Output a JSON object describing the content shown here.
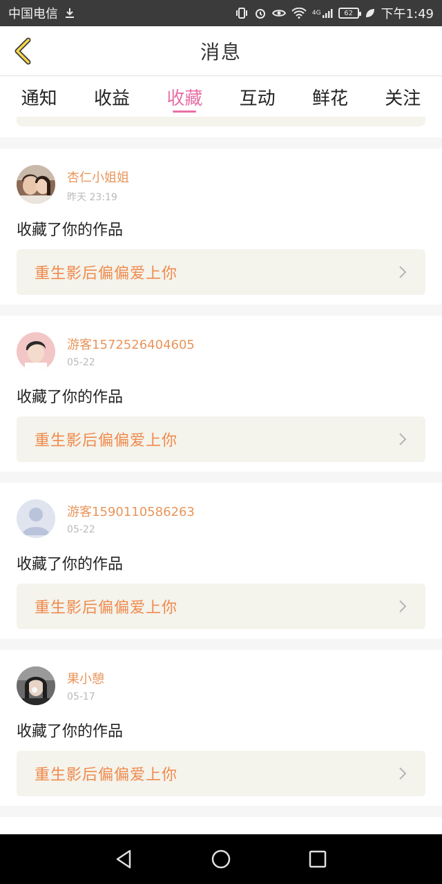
{
  "status_bar": {
    "carrier": "中国电信",
    "network": "4G",
    "battery": "62",
    "time": "下午1:49"
  },
  "header": {
    "title": "消息"
  },
  "tabs": [
    {
      "label": "通知",
      "active": false
    },
    {
      "label": "收益",
      "active": false
    },
    {
      "label": "收藏",
      "active": true
    },
    {
      "label": "互动",
      "active": false
    },
    {
      "label": "鲜花",
      "active": false
    },
    {
      "label": "关注",
      "active": false
    }
  ],
  "feed": [
    {
      "username": "杏仁小姐姐",
      "time": "昨天 23:19",
      "action": "收藏了你的作品",
      "work_title": "重生影后偏偏爱上你",
      "avatar": "photo-two-women"
    },
    {
      "username": "游客1572526404605",
      "time": "05-22",
      "action": "收藏了你的作品",
      "work_title": "重生影后偏偏爱上你",
      "avatar": "photo-young-man"
    },
    {
      "username": "游客15901105862​63",
      "time": "05-22",
      "action": "收藏了你的作品",
      "work_title": "重生影后偏偏爱上你",
      "avatar": "default-avatar"
    },
    {
      "username": "果小憩",
      "time": "05-17",
      "action": "收藏了你的作品",
      "work_title": "重生影后偏偏爱上你",
      "avatar": "photo-girl"
    }
  ],
  "colors": {
    "accent_pink": "#e86fa6",
    "username_orange": "#e8955a",
    "work_title_orange": "#f08a4b",
    "work_box_bg": "#f4f3ec"
  }
}
